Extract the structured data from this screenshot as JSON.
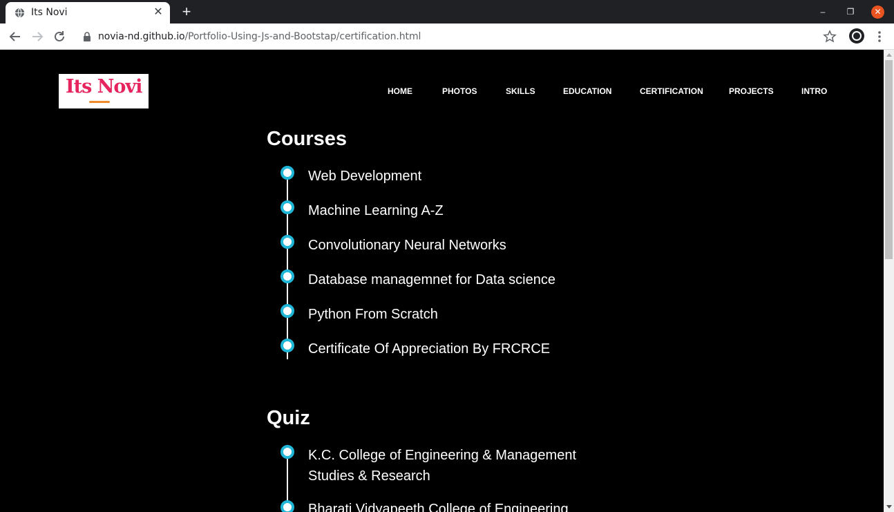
{
  "browser": {
    "tab_title": "Its Novi",
    "url_host": "novia-nd.github.io",
    "url_path": "/Portfolio-Using-Js-and-Bootstap/certification.html"
  },
  "logo": {
    "text": "Its Novi"
  },
  "nav": [
    "HOME",
    "PHOTOS",
    "SKILLS",
    "EDUCATION",
    "CERTIFICATION",
    "PROJECTS",
    "INTRO"
  ],
  "sections": {
    "courses": {
      "title": "Courses",
      "items": [
        "Web Development",
        "Machine Learning A-Z",
        "Convolutionary Neural Networks",
        "Database managemnet for Data science",
        "Python From Scratch",
        "Certificate Of Appreciation By FRCRCE"
      ]
    },
    "quiz": {
      "title": "Quiz",
      "items": [
        "K.C. College of Engineering & Management",
        "Studies & Research",
        "Bharati Vidyapeeth College of Engineering"
      ]
    }
  },
  "colors": {
    "accent": "#1fb6d8",
    "logo": "#e6245e",
    "logo_underline": "#f08a2b",
    "background": "#000000"
  }
}
